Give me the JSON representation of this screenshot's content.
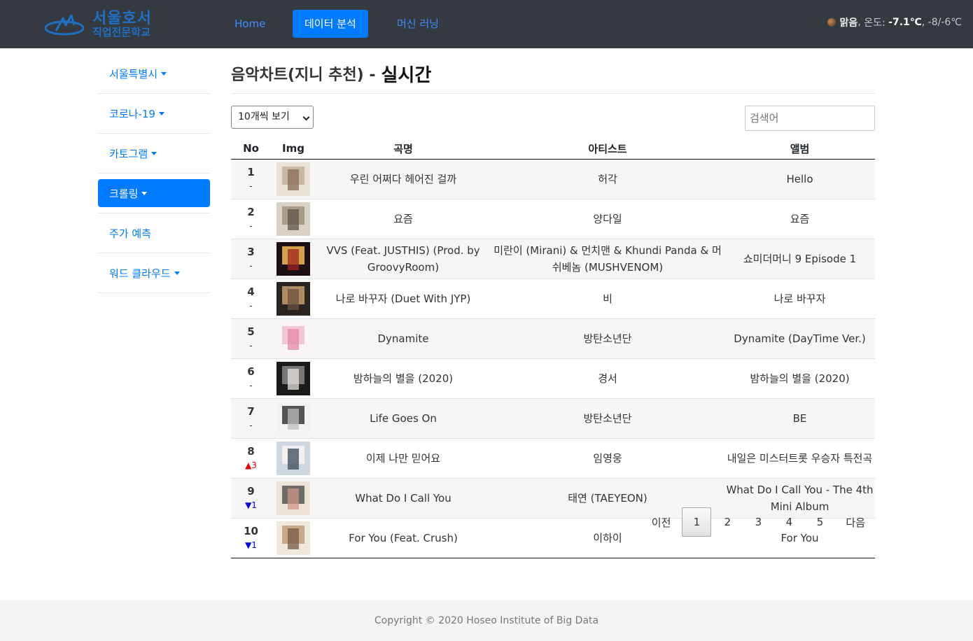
{
  "navbar": {
    "logo_line1": "서울호서",
    "logo_line2": "직업전문학교",
    "links": [
      "Home",
      "데이터 분석",
      "머신 러닝"
    ],
    "weather": {
      "condition": "맑음",
      "temp_label": "온도:",
      "temp": "-7.1℃",
      "range": "-8/-6℃"
    }
  },
  "sidebar": {
    "items": [
      {
        "label": "서울특별시",
        "dropdown": true
      },
      {
        "label": "코로나-19",
        "dropdown": true
      },
      {
        "label": "카토그램",
        "dropdown": true
      },
      {
        "label": "크롤링",
        "dropdown": true,
        "active": true
      },
      {
        "label": "주가 예측",
        "dropdown": false
      },
      {
        "label": "워드 클라우드",
        "dropdown": true
      }
    ]
  },
  "main": {
    "title": "음악차트(지니 추천) -",
    "title_strong": "실시간",
    "page_size": "10개씩 보기",
    "search_placeholder": "검색어",
    "columns": [
      "No",
      "Img",
      "곡명",
      "아티스트",
      "앨범"
    ],
    "rows": [
      {
        "no": "1",
        "change": "-",
        "dir": "same",
        "title": "우린 어쩌다 헤어진 걸까",
        "artist": "허각",
        "album": "Hello",
        "img": "album-hello"
      },
      {
        "no": "2",
        "change": "-",
        "dir": "same",
        "title": "요즘",
        "artist": "양다일",
        "album": "요즘",
        "img": "album-yojeum"
      },
      {
        "no": "3",
        "change": "-",
        "dir": "same",
        "title": "VVS (Feat. JUSTHIS) (Prod. by GroovyRoom)",
        "artist": "미란이 (Mirani) & 먼치맨 & Khundi Panda & 머쉬베놈 (MUSHVENOM)",
        "album": "쇼미더머니 9 Episode 1",
        "img": "album-smtm9"
      },
      {
        "no": "4",
        "change": "-",
        "dir": "same",
        "title": "나로 바꾸자 (Duet With JYP)",
        "artist": "비",
        "album": "나로 바꾸자",
        "img": "album-switch"
      },
      {
        "no": "5",
        "change": "-",
        "dir": "same",
        "title": "Dynamite",
        "artist": "방탄소년단",
        "album": "Dynamite (DayTime Ver.)",
        "img": "album-dynamite"
      },
      {
        "no": "6",
        "change": "-",
        "dir": "same",
        "title": "밤하늘의 별을 (2020)",
        "artist": "경서",
        "album": "밤하늘의 별을 (2020)",
        "img": "album-stars"
      },
      {
        "no": "7",
        "change": "-",
        "dir": "same",
        "title": "Life Goes On",
        "artist": "방탄소년단",
        "album": "BE",
        "img": "album-be"
      },
      {
        "no": "8",
        "change": "3",
        "dir": "up",
        "title": "이제 나만 믿어요",
        "artist": "임영웅",
        "album": "내일은 미스터트롯 우승자 특전곡",
        "img": "album-trust"
      },
      {
        "no": "9",
        "change": "1",
        "dir": "down",
        "title": "What Do I Call You",
        "artist": "태연 (TAEYEON)",
        "album": "What Do I Call You - The 4th Mini Album",
        "img": "album-whatdoi"
      },
      {
        "no": "10",
        "change": "1",
        "dir": "down",
        "title": "For You (Feat. Crush)",
        "artist": "이하이",
        "album": "For You",
        "img": "album-foryou"
      }
    ]
  },
  "pagination": {
    "prev": "이전",
    "pages": [
      "1",
      "2",
      "3",
      "4",
      "5"
    ],
    "current": "1",
    "next": "다음"
  },
  "footer": {
    "copyright": "Copyright © 2020 Hoseo Institute of Big Data"
  }
}
